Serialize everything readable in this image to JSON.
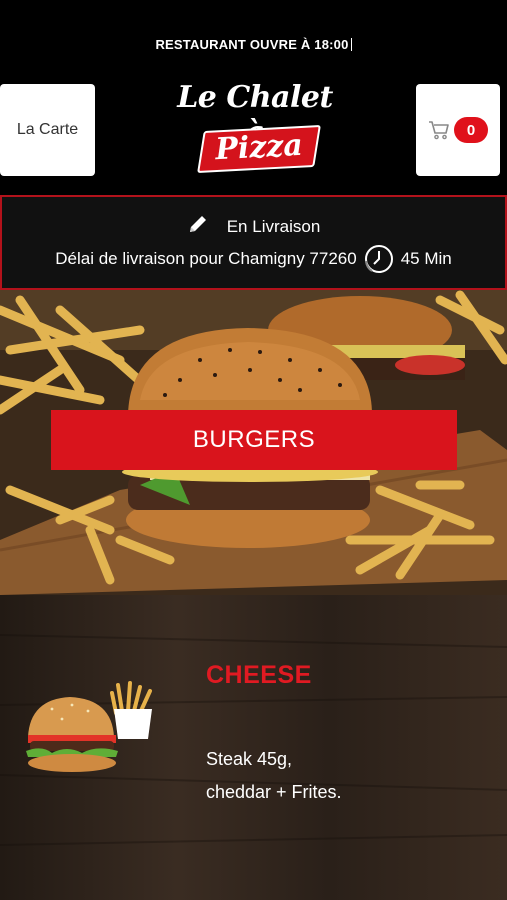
{
  "status": {
    "text": "RESTAURANT OUVRE À 18:00"
  },
  "header": {
    "menu_button": "La Carte",
    "logo_top": "Le Chalet à",
    "logo_bottom": "Pizza",
    "cart_count": "0",
    "cart_icon": "cart-icon"
  },
  "delivery": {
    "mode_icon": "pencil-icon",
    "mode": "En Livraison",
    "delay_text": "Délai de livraison pour Chamigny 77260",
    "clock_icon": "clock-icon",
    "delay_value": "45 Min",
    "border_color": "#b3121b"
  },
  "category": {
    "label": "BURGERS",
    "color": "#d9141c"
  },
  "product": {
    "name": "CHEESE",
    "description": "Steak 45g,\ncheddar  + Frites.",
    "name_color": "#e01a22"
  }
}
